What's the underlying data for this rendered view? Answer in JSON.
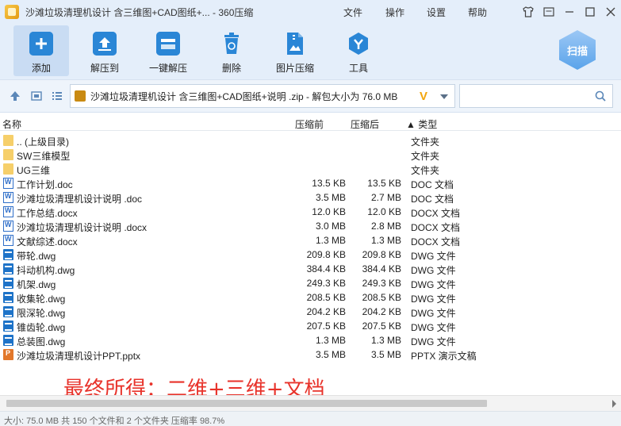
{
  "window": {
    "title": "沙滩垃圾清理机设计 含三维图+CAD图纸+... - 360压缩",
    "menu": [
      "文件",
      "操作",
      "设置",
      "帮助"
    ]
  },
  "toolbar": {
    "buttons": [
      {
        "label": "添加",
        "icon": "add-icon"
      },
      {
        "label": "解压到",
        "icon": "extract-to-icon"
      },
      {
        "label": "一键解压",
        "icon": "one-click-extract-icon"
      },
      {
        "label": "删除",
        "icon": "delete-icon"
      },
      {
        "label": "图片压缩",
        "icon": "image-compress-icon"
      },
      {
        "label": "工具",
        "icon": "tools-icon"
      }
    ],
    "scan_label": "扫描"
  },
  "address": {
    "path": "沙滩垃圾清理机设计 含三维图+CAD图纸+说明  .zip - 解包大小为 76.0 MB",
    "search_placeholder": ""
  },
  "columns": {
    "name": "名称",
    "size": "压缩前",
    "compressed": "压缩后",
    "type": "▲ 类型"
  },
  "files": [
    {
      "name": ".. (上级目录)",
      "size": "",
      "compressed": "",
      "type": "文件夹",
      "kind": "folder"
    },
    {
      "name": "SW三维模型",
      "size": "",
      "compressed": "",
      "type": "文件夹",
      "kind": "folder"
    },
    {
      "name": "UG三维",
      "size": "",
      "compressed": "",
      "type": "文件夹",
      "kind": "folder"
    },
    {
      "name": "工作计划.doc",
      "size": "13.5 KB",
      "compressed": "13.5 KB",
      "type": "DOC 文档",
      "kind": "doc"
    },
    {
      "name": "沙滩垃圾清理机设计说明  .doc",
      "size": "3.5 MB",
      "compressed": "2.7 MB",
      "type": "DOC 文档",
      "kind": "doc"
    },
    {
      "name": "工作总结.docx",
      "size": "12.0 KB",
      "compressed": "12.0 KB",
      "type": "DOCX 文档",
      "kind": "doc"
    },
    {
      "name": "沙滩垃圾清理机设计说明  .docx",
      "size": "3.0 MB",
      "compressed": "2.8 MB",
      "type": "DOCX 文档",
      "kind": "doc"
    },
    {
      "name": "文献综述.docx",
      "size": "1.3 MB",
      "compressed": "1.3 MB",
      "type": "DOCX 文档",
      "kind": "doc"
    },
    {
      "name": "带轮.dwg",
      "size": "209.8 KB",
      "compressed": "209.8 KB",
      "type": "DWG 文件",
      "kind": "dwg"
    },
    {
      "name": "抖动机构.dwg",
      "size": "384.4 KB",
      "compressed": "384.4 KB",
      "type": "DWG 文件",
      "kind": "dwg"
    },
    {
      "name": "机架.dwg",
      "size": "249.3 KB",
      "compressed": "249.3 KB",
      "type": "DWG 文件",
      "kind": "dwg"
    },
    {
      "name": "收集轮.dwg",
      "size": "208.5 KB",
      "compressed": "208.5 KB",
      "type": "DWG 文件",
      "kind": "dwg"
    },
    {
      "name": "限深轮.dwg",
      "size": "204.2 KB",
      "compressed": "204.2 KB",
      "type": "DWG 文件",
      "kind": "dwg"
    },
    {
      "name": "锥齿轮.dwg",
      "size": "207.5 KB",
      "compressed": "207.5 KB",
      "type": "DWG 文件",
      "kind": "dwg"
    },
    {
      "name": "总装图.dwg",
      "size": "1.3 MB",
      "compressed": "1.3 MB",
      "type": "DWG 文件",
      "kind": "dwg"
    },
    {
      "name": "沙滩垃圾清理机设计PPT.pptx",
      "size": "3.5 MB",
      "compressed": "3.5 MB",
      "type": "PPTX 演示文稿",
      "kind": "ppt"
    }
  ],
  "overlay": "最终所得：二维+三维+文档",
  "status": "大小: 75.0 MB 共 150 个文件和 2 个文件夹 压缩率 98.7%",
  "colors": {
    "accent": "#2a86d6",
    "chrome": "#e4eefa",
    "overlay": "#e8322a",
    "folder": "#f6cf6a"
  }
}
